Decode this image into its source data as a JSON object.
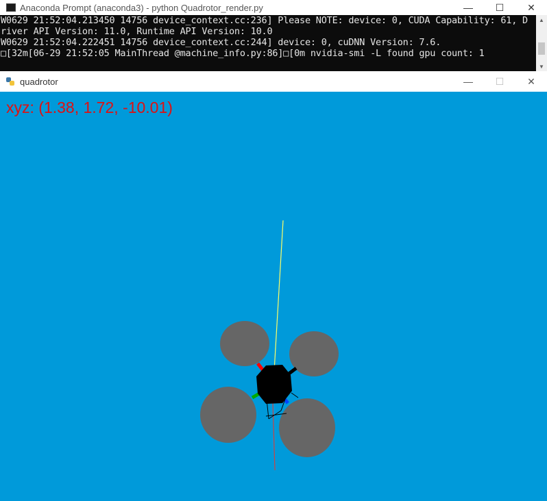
{
  "console": {
    "title": "Anaconda Prompt (anaconda3) - python  Quadrotor_render.py",
    "lines": [
      "W0629 21:52:04.213450 14756 device_context.cc:236] Please NOTE: device: 0, CUDA Capability: 61, D",
      "river API Version: 11.0, Runtime API Version: 10.0",
      "W0629 21:52:04.222451 14756 device_context.cc:244] device: 0, cuDNN Version: 7.6.",
      "□[32m[06-29 21:52:05 MainThread @machine_info.py:86]□[0m nvidia-smi -L found gpu count: 1"
    ],
    "buttons": {
      "minimize": "—",
      "maximize": "☐",
      "close": "✕"
    }
  },
  "render_window": {
    "title": "quadrotor",
    "buttons": {
      "minimize": "—",
      "maximize": "☐",
      "close": "✕"
    },
    "readout": "xyz: (1.38, 1.72, -10.01)",
    "colors": {
      "background": "#009ada",
      "rotor": "#666666",
      "body": "#000000",
      "axis_up": "#ffff66",
      "axis_down": "#cc4444",
      "arm_red": "#ff0000",
      "arm_green": "#00aa00",
      "arm_blue": "#0044ff"
    }
  }
}
